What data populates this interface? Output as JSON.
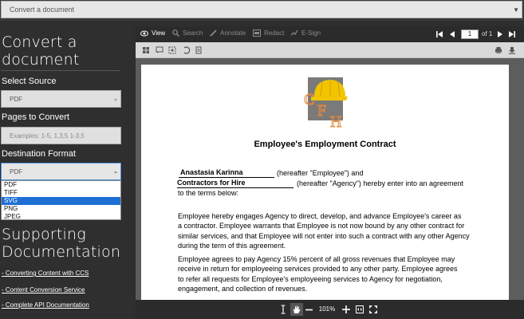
{
  "top_select": {
    "value": "Convert a document"
  },
  "left": {
    "heading": "Convert a document",
    "select_source_label": "Select Source",
    "source_value": "PDF",
    "pages_label": "Pages to Convert",
    "pages_placeholder": "Examples: 1-5, 1,3,5 1-3,5",
    "destination_label": "Destination Format",
    "destination_value": "PDF",
    "destination_options": [
      "PDF",
      "TIFF",
      "SVG",
      "PNG",
      "JPEG"
    ],
    "destination_highlighted": "SVG",
    "supporting_heading": "Supporting Documentation",
    "links": [
      "- Converting Content with CCS",
      "- Content Conversion Service",
      "- Complete API Documentation"
    ]
  },
  "viewer": {
    "tabs": [
      {
        "label": "View",
        "icon": "eye-icon",
        "active": true
      },
      {
        "label": "Search",
        "icon": "search-icon",
        "active": false
      },
      {
        "label": "Annotate",
        "icon": "pencil-icon",
        "active": false
      },
      {
        "label": "Redact",
        "icon": "redact-icon",
        "active": false
      },
      {
        "label": "E-Sign",
        "icon": "esign-icon",
        "active": false
      }
    ],
    "page_number": "1",
    "page_of": "of 1",
    "zoom": "101%"
  },
  "document": {
    "title": "Employee's Employment Contract",
    "employee_name": "Anastasia Karinna",
    "agency_name": "Contractors for Hire",
    "employee_suffix": "(hereafter \"Employee\") and",
    "agency_suffix": "(hereafter \"Agency\") hereby enter into an agreement",
    "terms_line": "to the terms below:",
    "para1": [
      "Employee hereby engages Agency to direct, develop, and advance Employee's career as",
      "a contractor. Employee warrants that Employee is not now bound by any other contract for",
      "similar services, and that Employee will not enter into such a contract with any other Agency",
      "during the term of this agreement."
    ],
    "para2": [
      "Employee agrees to pay Agency 15% percent of all gross revenues that Employee may",
      "receive in return for employeeing services provided to any other party. Employee agrees",
      "to refer all requests for Employee's employeeing services to Agency for negotiation,",
      "engagement, and collection of revenues."
    ],
    "logo_letters": [
      "C",
      "F",
      "H"
    ]
  },
  "colors": {
    "accent": "#1e6fd4",
    "panel": "#2f2f2f",
    "toolbar": "#2b2b2b",
    "logo_orange": "#e8883a",
    "hat_yellow": "#f2c400"
  }
}
